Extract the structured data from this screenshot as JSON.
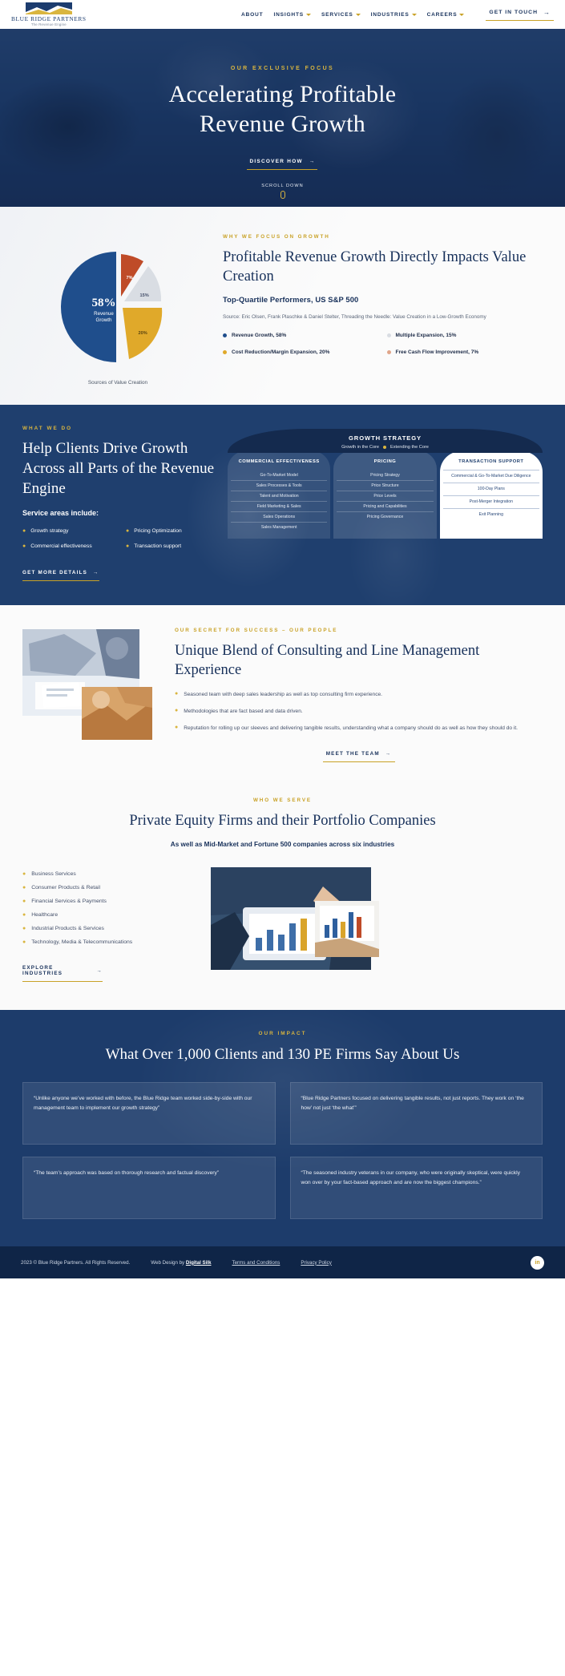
{
  "header": {
    "logo_title": "BLUE RIDGE PARTNERS",
    "logo_sub": "The Revenue Engine",
    "nav": [
      {
        "label": "ABOUT",
        "caret": false
      },
      {
        "label": "INSIGHTS",
        "caret": true
      },
      {
        "label": "SERVICES",
        "caret": true
      },
      {
        "label": "INDUSTRIES",
        "caret": true
      },
      {
        "label": "CAREERS",
        "caret": true
      }
    ],
    "cta_label": "GET IN TOUCH",
    "cta_arrow": "→"
  },
  "hero": {
    "eyebrow": "OUR EXCLUSIVE FOCUS",
    "title_line1": "Accelerating Profitable",
    "title_line2": "Revenue Growth",
    "button_label": "DISCOVER HOW",
    "button_arrow": "→",
    "scroll_label": "SCROLL DOWN"
  },
  "growth": {
    "eyebrow": "WHY WE FOCUS ON GROWTH",
    "heading": "Profitable Revenue Growth Directly Impacts Value Creation",
    "subhead": "Top-Quartile Performers, US S&P 500",
    "source": "Source: Eric Olsen, Frank Plaschke & Daniel Stelter, Threading the Needle: Value Creation in a Low-Growth Economy",
    "chart_caption": "Sources of Value Creation",
    "center_value": "58%",
    "center_label_1": "Revenue",
    "center_label_2": "Growth",
    "legend": [
      {
        "label": "Revenue Growth, 58%",
        "color": "#1f4e8c"
      },
      {
        "label": "Multiple Expansion, 15%",
        "color": "#d9dde3"
      },
      {
        "label": "Cost Reduction/Margin Expansion, 20%",
        "color": "#e0a92a"
      },
      {
        "label": "Free Cash Flow Improvement, 7%",
        "color": "#bf4b28"
      }
    ]
  },
  "chart_data": {
    "type": "pie",
    "title": "Sources of Value Creation",
    "categories": [
      "Revenue Growth",
      "Free Cash Flow Improvement",
      "Multiple Expansion",
      "Cost Reduction/Margin Expansion"
    ],
    "values": [
      58,
      7,
      15,
      20
    ],
    "labels": [
      "58%",
      "7%",
      "15%",
      "20%"
    ],
    "colors": [
      "#1f4e8c",
      "#bf4b28",
      "#d9dde3",
      "#e0a92a"
    ],
    "legend_position": "right",
    "center_text": "58% Revenue Growth"
  },
  "whatwedo": {
    "eyebrow": "WHAT WE DO",
    "heading": "Help Clients Drive Growth Across all Parts of the Revenue Engine",
    "service_label": "Service areas include:",
    "services": [
      "Growth strategy",
      "Pricing Optimization",
      "Commercial effectiveness",
      "Transaction support"
    ],
    "button_label": "GET MORE DETAILS",
    "button_arrow": "→",
    "diagram": {
      "title": "GROWTH STRATEGY",
      "legend_1": "Growth in the Core",
      "legend_2": "Extending the Core",
      "columns": [
        {
          "title": "COMMERCIAL EFFECTIVENESS",
          "items": [
            "Go-To-Market Model",
            "Sales Processes & Tools",
            "Talent and Motivation",
            "Field Marketing & Sales",
            "Sales Operations",
            "Sales Management"
          ]
        },
        {
          "title": "PRICING",
          "items": [
            "Pricing Strategy",
            "Price Structure",
            "Price Levels",
            "Pricing and Capabilities",
            "Pricing Governance"
          ]
        },
        {
          "title": "TRANSACTION SUPPORT",
          "items": [
            "Commercial & Go-To-Market Due Diligence",
            "100-Day Plans",
            "Post-Merger Integration",
            "Exit Planning"
          ]
        }
      ]
    }
  },
  "people": {
    "eyebrow": "OUR SECRET FOR SUCCESS – OUR PEOPLE",
    "heading": "Unique Blend of Consulting and Line Management Experience",
    "bullets": [
      "Seasoned team with deep sales leadership as well as top consulting firm experience.",
      "Methodologies that are fact based and data driven.",
      "Reputation for rolling up our sleeves and delivering tangible results, understanding what a company should do as well as how they should do it."
    ],
    "button_label": "MEET THE TEAM",
    "button_arrow": "→"
  },
  "serve": {
    "eyebrow": "WHO WE SERVE",
    "heading": "Private Equity Firms and their Portfolio Companies",
    "subhead": "As well as Mid-Market and Fortune 500 companies across six industries",
    "industries": [
      "Business Services",
      "Consumer Products & Retail",
      "Financial Services & Payments",
      "Healthcare",
      "Industrial Products & Services",
      "Technology, Media & Telecommunications"
    ],
    "button_label": "EXPLORE INDUSTRIES",
    "button_arrow": "→"
  },
  "impact": {
    "eyebrow": "OUR IMPACT",
    "heading": "What Over 1,000 Clients and 130 PE Firms Say About Us",
    "quotes": [
      "“Unlike anyone we’ve worked with before, the Blue Ridge team worked side-by-side with our management team to implement our growth strategy”",
      "“Blue Ridge Partners focused on delivering tangible results, not just reports. They work on ‘the how’ not just ‘the what’”",
      "“The team’s approach was based on thorough research and factual discovery”",
      "“The seasoned industry veterans in our company, who were originally skeptical, were quickly won over by your fact-based approach and are now the biggest champions.”"
    ]
  },
  "footer": {
    "copyright": "2023 © Blue Ridge Partners. All Rights Reserved.",
    "webdesign_prefix": "Web Design by ",
    "webdesign_link": "Digital Silk",
    "terms": "Terms and Conditions",
    "privacy": "Privacy Policy",
    "social_icon": "in"
  }
}
